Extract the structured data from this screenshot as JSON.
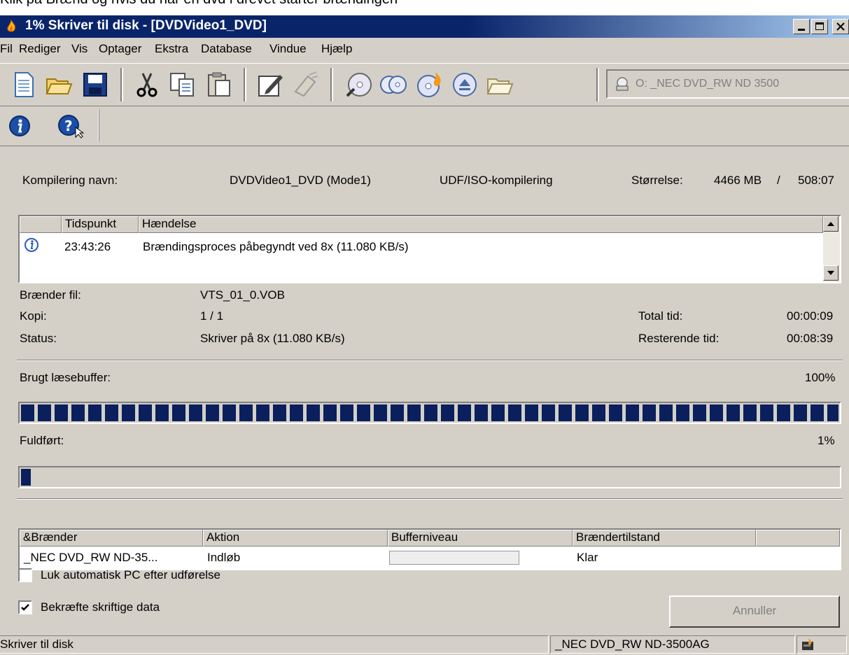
{
  "caption": "Klik på Brænd og hvis du har en dvd i drevet starter brændingen",
  "window": {
    "title": "1% Skriver til disk - [DVDVideo1_DVD]"
  },
  "menu": [
    "Fil",
    "Rediger",
    "Vis",
    "Optager",
    "Ekstra",
    "Database",
    "Vindue",
    "Hjælp"
  ],
  "toolbar": {
    "icons": [
      "new-document-icon",
      "open-folder-icon",
      "save-icon",
      "cut-icon",
      "copy-icon",
      "paste-icon",
      "write-compilation-icon",
      "erase-icon",
      "disc-info-icon",
      "copy-disc-icon",
      "burn-disc-icon",
      "eject-disc-icon",
      "folder-icon"
    ],
    "drive": "O: _NEC    DVD_RW ND 3500"
  },
  "toolbar2": {
    "icons": [
      "info-icon",
      "help-icon"
    ]
  },
  "compilation": {
    "name_label": "Kompilering navn:",
    "name_value": "DVDVideo1_DVD (Mode1)",
    "type": "UDF/ISO-kompilering",
    "size_label": "Størrelse:",
    "size_value": "4466 MB",
    "size_sep": "/",
    "size_total": "508:07"
  },
  "log": {
    "columns": [
      "Tidspunkt",
      "Hændelse"
    ],
    "rows": [
      {
        "icon": "info-icon",
        "time": "23:43:26",
        "event": "Brændingsproces påbegyndt ved 8x (11.080 KB/s)"
      }
    ]
  },
  "status": {
    "file_label": "Brænder fil:",
    "file_value": "VTS_01_0.VOB",
    "copy_label": "Kopi:",
    "copy_value": "1 / 1",
    "total_label": "Total tid:",
    "total_value": "00:00:09",
    "status_label": "Status:",
    "status_value": "Skriver på 8x (11.080 KB/s)",
    "remaining_label": "Resterende tid:",
    "remaining_value": "00:08:39"
  },
  "buffer": {
    "label": "Brugt læsebuffer:",
    "percent_text": "100%",
    "fraction": 1.0
  },
  "completed": {
    "label": "Fuldført:",
    "percent_text": "1%",
    "fraction": 0.01
  },
  "recorders": {
    "columns": [
      "&Brænder",
      "Aktion",
      "Bufferniveau",
      "Brændertilstand",
      ""
    ],
    "rows": [
      {
        "recorder": "_NEC DVD_RW ND-35...",
        "action": "Indløb",
        "buffer": "",
        "state": "Klar"
      }
    ]
  },
  "options": {
    "shutdown_label": "Luk automatisk PC efter udførelse",
    "shutdown_checked": false,
    "verify_label": "Bekræfte skriftige data",
    "verify_checked": true
  },
  "cancel_label": "Annuller",
  "statusbar": {
    "text": "Skriver til disk",
    "drive": "_NEC     DVD_RW ND-3500AG"
  },
  "colors": {
    "titlebar": "#0a246a",
    "progress": "#0a1f5c",
    "face": "#d4d0c8"
  }
}
